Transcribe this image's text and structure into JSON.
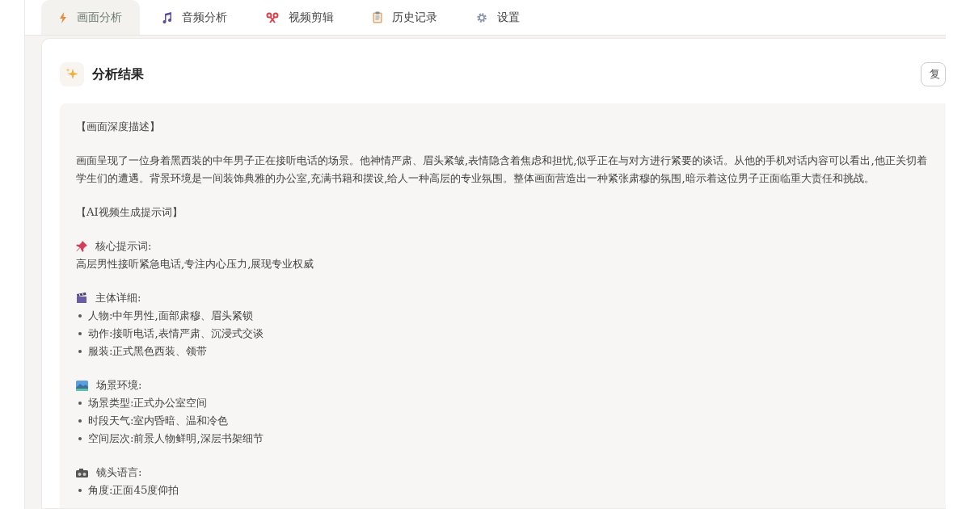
{
  "tabs": [
    {
      "label": "画面分析",
      "selected": true
    },
    {
      "label": "音频分析",
      "selected": false
    },
    {
      "label": "视频剪辑",
      "selected": false
    },
    {
      "label": "历史记录",
      "selected": false
    },
    {
      "label": "设置",
      "selected": false
    }
  ],
  "result": {
    "title": "分析结果",
    "action_button": "复",
    "groups": [
      {
        "lines": [
          {
            "kind": "heading",
            "text": "【画面深度描述】"
          }
        ]
      },
      {
        "lines": [
          {
            "kind": "paragraph",
            "text": "画面呈现了一位身着黑西装的中年男子正在接听电话的场景。他神情严肃、眉头紧皱,表情隐含着焦虑和担忧,似乎正在与对方进行紧要的谈话。从他的手机对话内容可以看出,他正关切着学生们的遭遇。背景环境是一间装饰典雅的办公室,充满书籍和摆设,给人一种高层的专业氛围。整体画面营造出一种紧张肃穆的氛围,暗示着这位男子正面临重大责任和挑战。"
          }
        ]
      },
      {
        "lines": [
          {
            "kind": "heading",
            "text": "【AI视频生成提示词】"
          }
        ]
      },
      {
        "lines": [
          {
            "kind": "subheading",
            "text": "核心提示词:"
          },
          {
            "kind": "line",
            "text": "高层男性接听紧急电话,专注内心压力,展现专业权威"
          }
        ]
      },
      {
        "lines": [
          {
            "kind": "subheading",
            "text": "主体详细:"
          },
          {
            "kind": "bullet",
            "text": "人物:中年男性,面部肃穆、眉头紧锁"
          },
          {
            "kind": "bullet",
            "text": "动作:接听电话,表情严肃、沉浸式交谈"
          },
          {
            "kind": "bullet",
            "text": "服装:正式黑色西装、领带"
          }
        ]
      },
      {
        "lines": [
          {
            "kind": "subheading",
            "text": "场景环境:"
          },
          {
            "kind": "bullet",
            "text": "场景类型:正式办公室空间"
          },
          {
            "kind": "bullet",
            "text": "时段天气:室内昏暗、温和冷色"
          },
          {
            "kind": "bullet",
            "text": "空间层次:前景人物鲜明,深层书架细节"
          }
        ]
      },
      {
        "lines": [
          {
            "kind": "subheading",
            "text": "镜头语言:"
          },
          {
            "kind": "bullet",
            "text": "角度:正面45度仰拍"
          }
        ]
      }
    ]
  }
}
